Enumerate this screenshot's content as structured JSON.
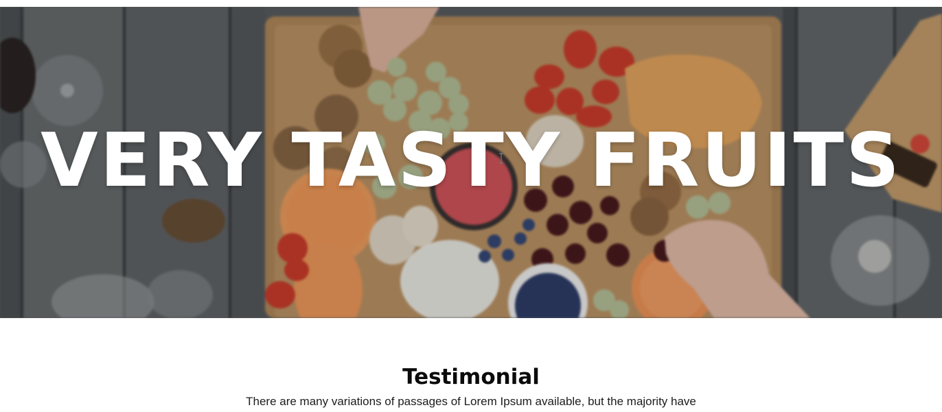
{
  "hero": {
    "title": "VERY TASTY FRUITS",
    "image_name": "fruit-charcuterie-board-photo"
  },
  "testimonial": {
    "heading": "Testimonial",
    "text": "There are many variations of passages of Lorem Ipsum available, but the majority have"
  },
  "colors": {
    "hero_text": "#ffffff",
    "heading_text": "#0b0b0b",
    "body_text": "#1c1c1c",
    "page_background": "#ffffff"
  },
  "icons": {
    "cursor": "text-cursor-icon"
  }
}
